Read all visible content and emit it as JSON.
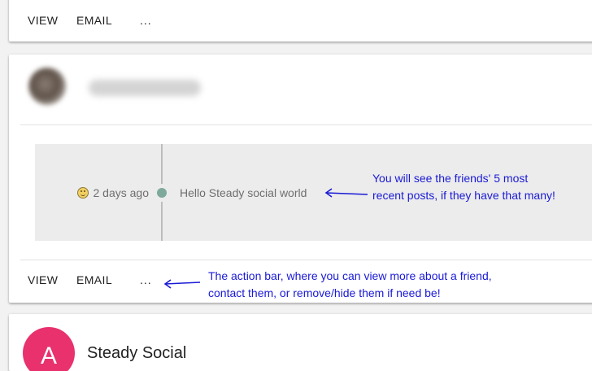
{
  "card_top": {
    "actions": {
      "view": "VIEW",
      "email": "EMAIL",
      "more": "..."
    }
  },
  "friend_card": {
    "post": {
      "time": "2 days ago",
      "mood_icon": "smiley-icon",
      "text": "Hello Steady social world"
    },
    "actions": {
      "view": "VIEW",
      "email": "EMAIL",
      "more": "..."
    }
  },
  "annotations": {
    "posts_note": [
      "You will see the friends' 5 most",
      "recent posts, if they have that many!"
    ],
    "actions_note": [
      "The action bar, where you can view more about a friend,",
      "contact them, or remove/hide them if need be!"
    ],
    "color": "#1a1ad6"
  },
  "next_card": {
    "avatar_letter": "A",
    "name": "Steady Social",
    "avatar_color": "#e8316d"
  }
}
